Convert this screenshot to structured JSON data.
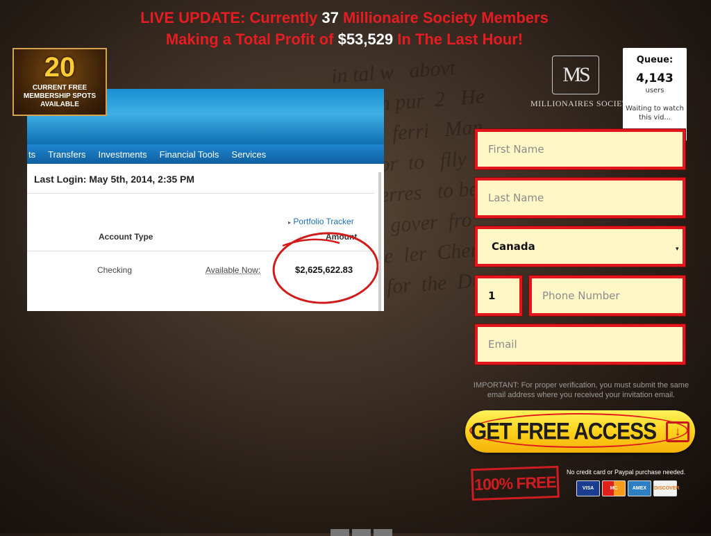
{
  "headline": {
    "line1_prefix": "LIVE UPDATE: Currently",
    "members_count": "37",
    "line1_suffix": "Millionaire Society Members",
    "line2_prefix": "Making a Total Profit of",
    "profit": "$53,529",
    "line2_suffix": "In The Last Hour!"
  },
  "badge": {
    "number": "20",
    "line1": "CURRENT FREE",
    "line2": "MEMBERSHIP SPOTS",
    "line3": "AVAILABLE"
  },
  "video": {
    "nav": [
      "ts",
      "Transfers",
      "Investments",
      "Financial Tools",
      "Services"
    ],
    "last_login": "Last Login: May 5th, 2014, 2:35 PM",
    "tracker_link": "Portfolio Tracker",
    "col_account_type": "Account Type",
    "col_amount": "Amount",
    "account_type": "Checking",
    "available_label": "Available Now:",
    "amount": "$2,625,622.83"
  },
  "logo": {
    "mark": "MS",
    "name": "MILLIONAIRES SOCIETY"
  },
  "queue": {
    "title": "Queue:",
    "count": "4,143",
    "unit": "users",
    "waiting": "Waiting to watch this vid..."
  },
  "form": {
    "first_name_placeholder": "First Name",
    "last_name_placeholder": "Last Name",
    "country": "Canada",
    "country_code": "1",
    "phone_placeholder": "Phone Number",
    "email_placeholder": "Email",
    "important_note": "IMPORTANT: For proper verification, you must submit the same email address where you received your invitation email.",
    "cta_label": "GET FREE ACCESS"
  },
  "trust": {
    "free_badge": "100% FREE",
    "no_credit_card": "No credit card or Paypal purchase needed.",
    "cards": [
      "VISA",
      "MC",
      "AMEX",
      "DISCOVER"
    ]
  },
  "colors": {
    "accent_red": "#e2161c",
    "field_bg": "#fff7c6",
    "cta_yellow": "#ffd21c"
  }
}
